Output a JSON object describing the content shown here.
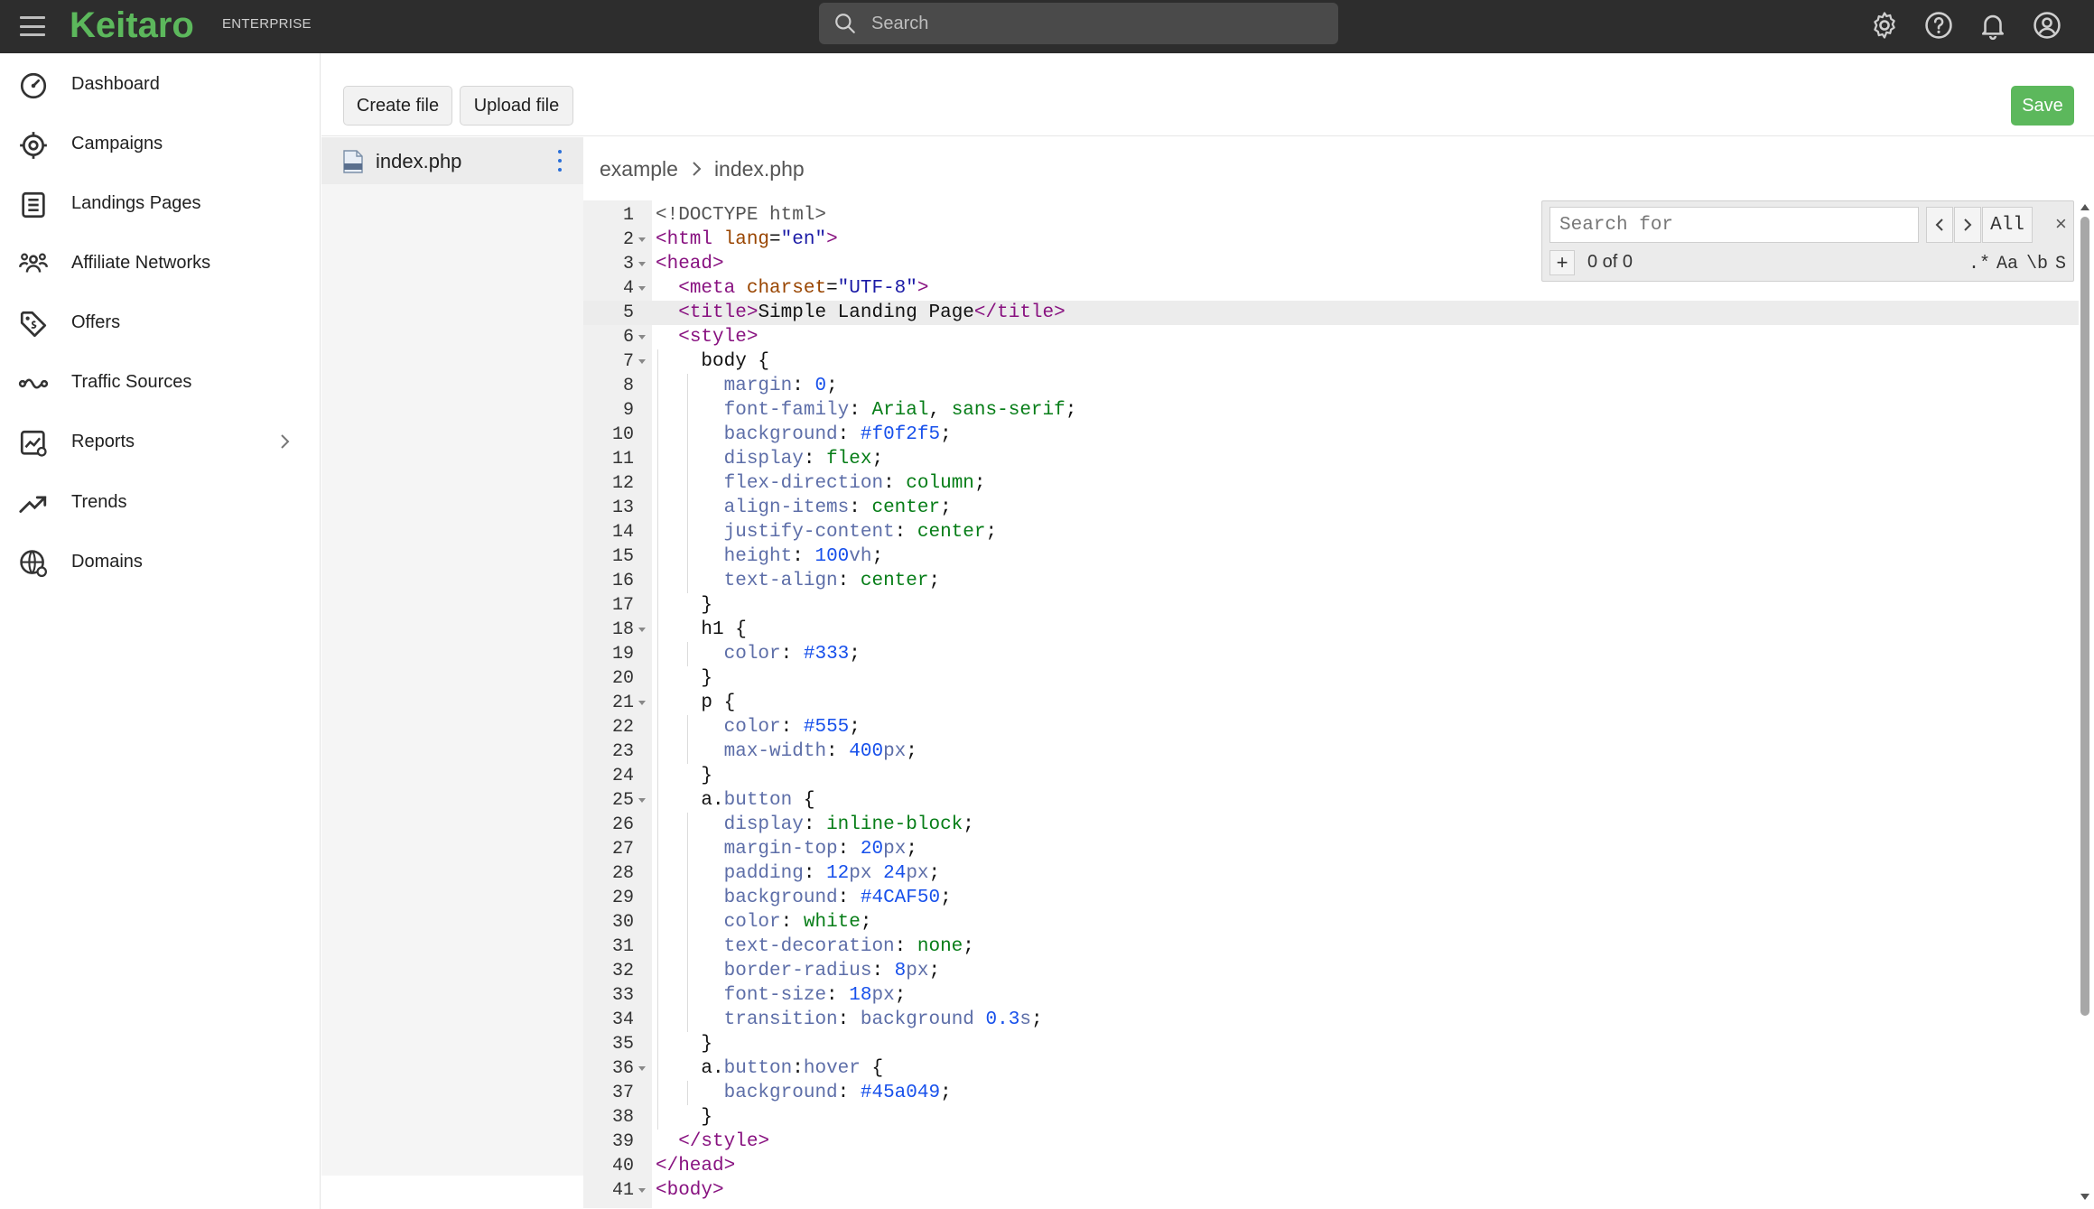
{
  "header": {
    "logo": "Keitaro",
    "edition": "ENTERPRISE",
    "search_placeholder": "Search",
    "icons": [
      "gear-icon",
      "help-icon",
      "bell-icon",
      "account-icon"
    ]
  },
  "sidebar": {
    "items": [
      {
        "label": "Dashboard",
        "icon": "gauge-icon"
      },
      {
        "label": "Campaigns",
        "icon": "target-icon"
      },
      {
        "label": "Landings Pages",
        "icon": "document-icon"
      },
      {
        "label": "Affiliate Networks",
        "icon": "people-icon"
      },
      {
        "label": "Offers",
        "icon": "tag-icon"
      },
      {
        "label": "Traffic Sources",
        "icon": "route-icon"
      },
      {
        "label": "Reports",
        "icon": "report-chart-icon",
        "has_submenu": true
      },
      {
        "label": "Trends",
        "icon": "trend-icon"
      },
      {
        "label": "Domains",
        "icon": "globe-icon"
      }
    ]
  },
  "toolbar": {
    "create_file": "Create file",
    "upload_file": "Upload file",
    "save": "Save"
  },
  "file_panel": {
    "files": [
      {
        "name": "index.php"
      }
    ]
  },
  "breadcrumb": [
    "example",
    "index.php"
  ],
  "editor": {
    "active_line": 5,
    "lines": [
      "<!DOCTYPE html>",
      "<html lang=\"en\">",
      "<head>",
      "  <meta charset=\"UTF-8\">",
      "  <title>Simple Landing Page</title>",
      "  <style>",
      "    body {",
      "      margin: 0;",
      "      font-family: Arial, sans-serif;",
      "      background: #f0f2f5;",
      "      display: flex;",
      "      flex-direction: column;",
      "      align-items: center;",
      "      justify-content: center;",
      "      height: 100vh;",
      "      text-align: center;",
      "    }",
      "    h1 {",
      "      color: #333;",
      "    }",
      "    p {",
      "      color: #555;",
      "      max-width: 400px;",
      "    }",
      "    a.button {",
      "      display: inline-block;",
      "      margin-top: 20px;",
      "      padding: 12px 24px;",
      "      background: #4CAF50;",
      "      color: white;",
      "      text-decoration: none;",
      "      border-radius: 8px;",
      "      font-size: 18px;",
      "      transition: background 0.3s;",
      "    }",
      "    a.button:hover {",
      "      background: #45a049;",
      "    }",
      "  </style>",
      "</head>",
      "<body>"
    ],
    "fold_lines": [
      2,
      3,
      4,
      6,
      7,
      18,
      21,
      25,
      36,
      41
    ]
  },
  "find": {
    "placeholder": "Search for",
    "prev": "<",
    "next": ">",
    "all": "All",
    "close": "×",
    "add": "+",
    "count": "0 of 0",
    "opt_regex": ".*",
    "opt_case": "Aa",
    "opt_word": "\\b",
    "opt_selection": "S"
  },
  "colors": {
    "topbar": "#2d2d2d",
    "brand_green": "#5cb85c",
    "tag": "#881280",
    "attribute": "#994500",
    "string": "#1a1aa6",
    "property": "#5d6ea8",
    "value": "#067d17",
    "number": "#1750eb"
  }
}
